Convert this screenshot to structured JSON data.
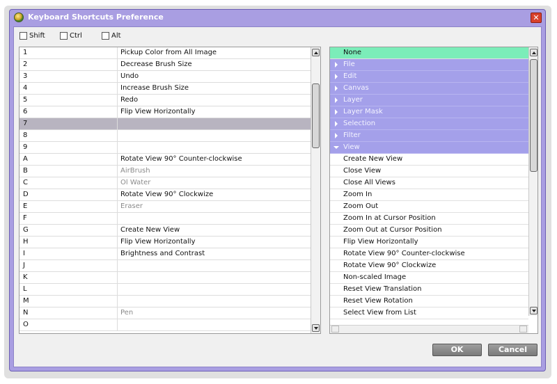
{
  "window": {
    "title": "Keyboard Shortcuts Preference",
    "close_glyph": "✕"
  },
  "modifiers": [
    {
      "label": "Shift",
      "checked": false
    },
    {
      "label": "Ctrl",
      "checked": false
    },
    {
      "label": "Alt",
      "checked": false
    }
  ],
  "key_table": {
    "rows": [
      {
        "key": "1",
        "action": "Pickup Color from All Image",
        "grey": false
      },
      {
        "key": "2",
        "action": "Decrease Brush Size",
        "grey": false
      },
      {
        "key": "3",
        "action": "Undo",
        "grey": false
      },
      {
        "key": "4",
        "action": "Increase Brush Size",
        "grey": false
      },
      {
        "key": "5",
        "action": "Redo",
        "grey": false
      },
      {
        "key": "6",
        "action": "Flip View Horizontally",
        "grey": false
      },
      {
        "key": "7",
        "action": "",
        "grey": false,
        "selected": true
      },
      {
        "key": "8",
        "action": "",
        "grey": false
      },
      {
        "key": "9",
        "action": "",
        "grey": false
      },
      {
        "key": "A",
        "action": "Rotate View 90° Counter-clockwise",
        "grey": false
      },
      {
        "key": "B",
        "action": "AirBrush",
        "grey": true
      },
      {
        "key": "C",
        "action": "Ol Water",
        "grey": true
      },
      {
        "key": "D",
        "action": "Rotate View 90° Clockwize",
        "grey": false
      },
      {
        "key": "E",
        "action": "Eraser",
        "grey": true
      },
      {
        "key": "F",
        "action": "",
        "grey": false
      },
      {
        "key": "G",
        "action": "Create New View",
        "grey": false
      },
      {
        "key": "H",
        "action": "Flip View Horizontally",
        "grey": false
      },
      {
        "key": "I",
        "action": "Brightness and Contrast",
        "grey": false
      },
      {
        "key": "J",
        "action": "",
        "grey": false
      },
      {
        "key": "K",
        "action": "",
        "grey": false
      },
      {
        "key": "L",
        "action": "",
        "grey": false
      },
      {
        "key": "M",
        "action": "",
        "grey": false
      },
      {
        "key": "N",
        "action": "Pen",
        "grey": true
      },
      {
        "key": "O",
        "action": "",
        "grey": false
      }
    ]
  },
  "action_tree": {
    "items": [
      {
        "label": "None",
        "kind": "none"
      },
      {
        "label": "File",
        "kind": "category",
        "expanded": false
      },
      {
        "label": "Edit",
        "kind": "category",
        "expanded": false
      },
      {
        "label": "Canvas",
        "kind": "category",
        "expanded": false
      },
      {
        "label": "Layer",
        "kind": "category",
        "expanded": false
      },
      {
        "label": "Layer Mask",
        "kind": "category",
        "expanded": false
      },
      {
        "label": "Selection",
        "kind": "category",
        "expanded": false
      },
      {
        "label": "Filter",
        "kind": "category",
        "expanded": false
      },
      {
        "label": "View",
        "kind": "category",
        "expanded": true
      },
      {
        "label": "Create New View",
        "kind": "item"
      },
      {
        "label": "Close View",
        "kind": "item"
      },
      {
        "label": "Close All Views",
        "kind": "item"
      },
      {
        "label": "Zoom In",
        "kind": "item"
      },
      {
        "label": "Zoom Out",
        "kind": "item"
      },
      {
        "label": "Zoom In at Cursor Position",
        "kind": "item"
      },
      {
        "label": "Zoom Out at Cursor Position",
        "kind": "item"
      },
      {
        "label": "Flip View Horizontally",
        "kind": "item"
      },
      {
        "label": "Rotate View 90° Counter-clockwise",
        "kind": "item"
      },
      {
        "label": "Rotate View 90° Clockwize",
        "kind": "item"
      },
      {
        "label": "Non-scaled Image",
        "kind": "item"
      },
      {
        "label": "Reset View Translation",
        "kind": "item"
      },
      {
        "label": "Reset View Rotation",
        "kind": "item"
      },
      {
        "label": "Select View from List",
        "kind": "item"
      }
    ]
  },
  "buttons": {
    "ok": "OK",
    "cancel": "Cancel"
  },
  "colors": {
    "window_frame": "#a99ee2",
    "category_row": "#a4a0ea",
    "none_row": "#7bedb9",
    "selected_row": "#b8b4c0"
  }
}
